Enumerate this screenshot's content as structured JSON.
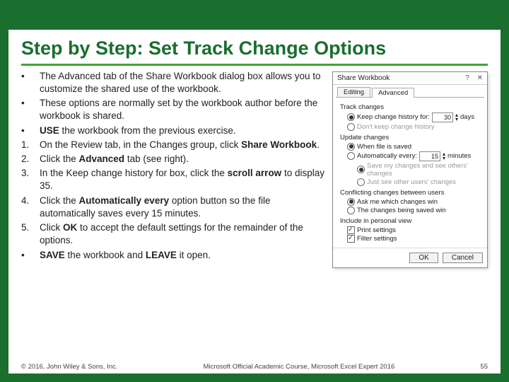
{
  "title": "Step by Step: Set Track Change Options",
  "items": [
    {
      "marker": "•",
      "segments": [
        "The Advanced tab of the Share Workbook dialog box allows you to customize the shared use of the workbook."
      ]
    },
    {
      "marker": "•",
      "segments": [
        "These options are normally set by the workbook author before the workbook is shared."
      ]
    },
    {
      "marker": "•",
      "segments": [
        {
          "b": true,
          "t": "USE"
        },
        " the workbook from the previous exercise."
      ]
    },
    {
      "marker": "1.",
      "segments": [
        "On the Review tab, in the Changes group, click ",
        {
          "b": true,
          "t": "Share Workbook"
        },
        "."
      ]
    },
    {
      "marker": "2.",
      "segments": [
        "Click the ",
        {
          "b": true,
          "t": "Advanced"
        },
        " tab (see right)."
      ]
    },
    {
      "marker": "3.",
      "segments": [
        "In the Keep change history for box, click the ",
        {
          "b": true,
          "t": "scroll arrow"
        },
        " to display 35."
      ]
    },
    {
      "marker": "4.",
      "segments": [
        "Click the ",
        {
          "b": true,
          "t": "Automatically every"
        },
        " option button so the file automatically saves every 15 minutes."
      ]
    },
    {
      "marker": "5.",
      "segments": [
        "Click ",
        {
          "b": true,
          "t": "OK"
        },
        " to accept the default settings for the remainder of the options."
      ]
    },
    {
      "marker": "•",
      "segments": [
        {
          "b": true,
          "t": "SAVE"
        },
        " the workbook and ",
        {
          "b": true,
          "t": "LEAVE"
        },
        " it open."
      ]
    }
  ],
  "dialog": {
    "title": "Share Workbook",
    "tabs": {
      "editing": "Editing",
      "advanced": "Advanced"
    },
    "track_changes": {
      "label": "Track changes",
      "keep": "Keep change history for:",
      "days_value": "30",
      "days_unit": "days",
      "dont": "Don't keep change history"
    },
    "update": {
      "label": "Update changes",
      "saved": "When file is saved",
      "auto": "Automatically every:",
      "min_value": "15",
      "min_unit": "minutes",
      "save_mine": "Save my changes and see others' changes",
      "just_see": "Just see other users' changes"
    },
    "conflict": {
      "label": "Conflicting changes between users",
      "ask": "Ask me which changes win",
      "saved": "The changes being saved win"
    },
    "personal": {
      "label": "Include in personal view",
      "print": "Print settings",
      "filter": "Filter settings"
    },
    "buttons": {
      "ok": "OK",
      "cancel": "Cancel"
    }
  },
  "footer": {
    "left": "© 2016, John Wiley & Sons, Inc.",
    "center": "Microsoft Official Academic Course, Microsoft Excel Expert 2016",
    "right": "55"
  }
}
